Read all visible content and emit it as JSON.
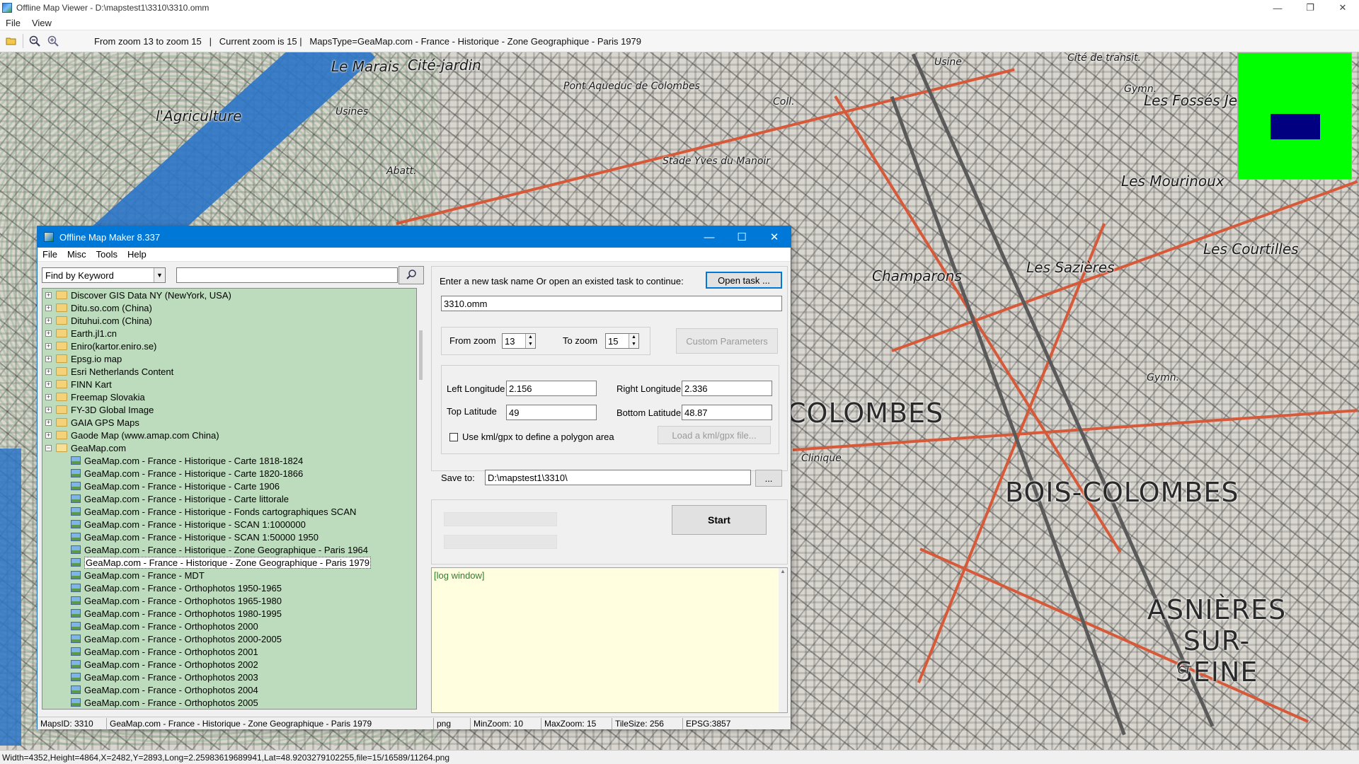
{
  "viewer": {
    "title": "Offline Map Viewer - D:\\mapstest1\\3310\\3310.omm",
    "menu": [
      "File",
      "View"
    ],
    "toolbar_info": "From zoom 13 to zoom 15   |   Current zoom is 15 |   MapsType=GeaMap.com - France - Historique - Zone Geographique - Paris 1979",
    "status": "Width=4352,Height=4864,X=2482,Y=2893,Long=2.25983619689941,Lat=48.9203279102255,file=15/16589/11264.png",
    "icons": [
      "open-folder-icon",
      "zoom-out-icon",
      "zoom-in-icon"
    ]
  },
  "map_labels": [
    "Le Marais",
    "Cité-jardin",
    "Cité de transit.",
    "Usine",
    "l'Agriculture",
    "Usines",
    "Pont Aqueduc de Colombes",
    "Les Fossés Jean",
    "Stade Yves du Manoir",
    "Les Mourinoux",
    "Gymn.",
    "Les Courtilles",
    "Champarons",
    "Les Sazières",
    "Abatt.",
    "Coll.",
    "COLOMBES",
    "BOIS-COLOMBES",
    "ASNIÈRES SUR-SEINE",
    "Clinique",
    "Gymn.",
    "CT"
  ],
  "overview": {
    "color": "#00ff00",
    "viewport_color": "#000080"
  },
  "maker": {
    "title": "Offline Map Maker 8.337",
    "menu": [
      "File",
      "Misc",
      "Tools",
      "Help"
    ],
    "search": {
      "mode": "Find by Keyword",
      "value": ""
    },
    "tree": [
      {
        "label": "Discover GIS Data NY (NewYork, USA)",
        "expanded": false
      },
      {
        "label": "Ditu.so.com (China)",
        "expanded": false
      },
      {
        "label": "Dituhui.com (China)",
        "expanded": false
      },
      {
        "label": "Earth.jl1.cn",
        "expanded": false
      },
      {
        "label": "Eniro(kartor.eniro.se)",
        "expanded": false
      },
      {
        "label": "Epsg.io map",
        "expanded": false
      },
      {
        "label": "Esri Netherlands Content",
        "expanded": false
      },
      {
        "label": "FINN Kart",
        "expanded": false
      },
      {
        "label": "Freemap Slovakia",
        "expanded": false
      },
      {
        "label": "FY-3D Global Image",
        "expanded": false
      },
      {
        "label": "GAIA GPS Maps",
        "expanded": false
      },
      {
        "label": "Gaode Map (www.amap.com China)",
        "expanded": false
      },
      {
        "label": "GeaMap.com",
        "expanded": true
      }
    ],
    "tree_children": [
      "GeaMap.com - France - Historique - Carte 1818-1824",
      "GeaMap.com - France - Historique - Carte 1820-1866",
      "GeaMap.com - France - Historique - Carte 1906",
      "GeaMap.com - France - Historique - Carte littorale",
      "GeaMap.com - France - Historique - Fonds cartographiques SCAN",
      "GeaMap.com - France - Historique - SCAN 1:1000000",
      "GeaMap.com - France - Historique - SCAN 1:50000 1950",
      "GeaMap.com - France - Historique - Zone Geographique - Paris 1964",
      "GeaMap.com - France - Historique - Zone Geographique - Paris 1979",
      "GeaMap.com - France - MDT",
      "GeaMap.com - France - Orthophotos 1950-1965",
      "GeaMap.com - France - Orthophotos 1965-1980",
      "GeaMap.com - France - Orthophotos 1980-1995",
      "GeaMap.com - France - Orthophotos 2000",
      "GeaMap.com - France - Orthophotos 2000-2005",
      "GeaMap.com - France - Orthophotos 2001",
      "GeaMap.com - France - Orthophotos 2002",
      "GeaMap.com - France - Orthophotos 2003",
      "GeaMap.com - France - Orthophotos 2004",
      "GeaMap.com - France - Orthophotos 2005"
    ],
    "selected_child": "GeaMap.com - France - Historique - Zone Geographique - Paris 1979",
    "task_prompt": "Enter a new task name Or open an existed task to continue:",
    "open_task_label": "Open task ...",
    "task_name": "3310.omm",
    "from_zoom_label": "From zoom",
    "from_zoom": "13",
    "to_zoom_label": "To zoom",
    "to_zoom": "15",
    "custom_params_label": "Custom Parameters",
    "left_lon_label": "Left Longitude",
    "left_lon": "2.156",
    "right_lon_label": "Right Longitude",
    "right_lon": "2.336",
    "top_lat_label": "Top Latitude",
    "top_lat": "49",
    "bottom_lat_label": "Bottom Latitude",
    "bottom_lat": "48.87",
    "kml_label": "Use kml/gpx to define a polygon area",
    "kml_checked": false,
    "load_kml_label": "Load a kml/gpx file...",
    "save_to_label": "Save to:",
    "save_to": "D:\\mapstest1\\3310\\",
    "browse_label": "...",
    "start_label": "Start",
    "log_text": "[log window]",
    "status": {
      "maps_id": "MapsID: 3310",
      "maps_name": "GeaMap.com - France - Historique - Zone Geographique - Paris 1979",
      "format": "png",
      "min_zoom": "MinZoom: 10",
      "max_zoom": "MaxZoom: 15",
      "tile_size": "TileSize: 256",
      "epsg": "EPSG:3857"
    }
  }
}
